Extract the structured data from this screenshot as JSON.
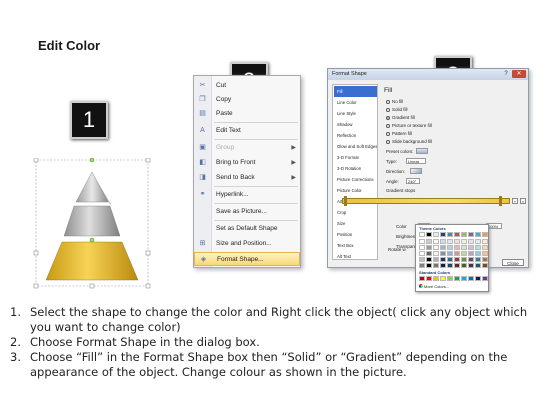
{
  "title": "Edit Color",
  "step_badges": [
    "1",
    "2",
    "3"
  ],
  "context_menu": {
    "items": [
      {
        "label": "Cut",
        "icon": "scissors-icon",
        "glyph": "✂",
        "enabled": true,
        "submenu": false
      },
      {
        "label": "Copy",
        "icon": "copy-icon",
        "glyph": "❐",
        "enabled": true,
        "submenu": false
      },
      {
        "label": "Paste",
        "icon": "paste-icon",
        "glyph": "▤",
        "enabled": true,
        "submenu": false
      },
      {
        "label": "Edit Text",
        "icon": "edit-text-icon",
        "glyph": "A",
        "enabled": true,
        "submenu": false
      },
      {
        "label": "Group",
        "icon": "group-icon",
        "glyph": "▣",
        "enabled": false,
        "submenu": true
      },
      {
        "label": "Bring to Front",
        "icon": "bring-to-front-icon",
        "glyph": "◧",
        "enabled": true,
        "submenu": true
      },
      {
        "label": "Send to Back",
        "icon": "send-to-back-icon",
        "glyph": "◨",
        "enabled": true,
        "submenu": true
      },
      {
        "label": "Hyperlink...",
        "icon": "hyperlink-icon",
        "glyph": "⚭",
        "enabled": true,
        "submenu": false
      },
      {
        "label": "Save as Picture...",
        "icon": "",
        "glyph": "",
        "enabled": true,
        "submenu": false
      },
      {
        "label": "Set as Default Shape",
        "icon": "",
        "glyph": "",
        "enabled": true,
        "submenu": false
      },
      {
        "label": "Size and Position...",
        "icon": "size-position-icon",
        "glyph": "⊞",
        "enabled": true,
        "submenu": false
      },
      {
        "label": "Format Shape...",
        "icon": "format-shape-icon",
        "glyph": "◈",
        "enabled": true,
        "submenu": false,
        "highlighted": true
      }
    ]
  },
  "format_dialog": {
    "title": "Format Shape",
    "help": "?",
    "close_glyph": "✕",
    "nav_items": [
      "Fill",
      "Line Color",
      "Line Style",
      "Shadow",
      "Reflection",
      "Glow and Soft Edges",
      "3-D Format",
      "3-D Rotation",
      "Picture Corrections",
      "Picture Color",
      "Artistic Effects",
      "Crop",
      "Size",
      "Position",
      "Text Box",
      "Alt Text"
    ],
    "selected_nav": "Fill",
    "fill": {
      "heading": "Fill",
      "options": [
        {
          "label": "No fill",
          "selected": false
        },
        {
          "label": "Solid fill",
          "selected": false
        },
        {
          "label": "Gradient fill",
          "selected": true
        },
        {
          "label": "Picture or texture fill",
          "selected": false
        },
        {
          "label": "Pattern fill",
          "selected": false
        },
        {
          "label": "Slide background fill",
          "selected": false
        }
      ],
      "preset_colors_label": "Preset colors:",
      "type_label": "Type:",
      "type_value": "Linear",
      "direction_label": "Direction:",
      "angle_label": "Angle:",
      "angle_value": "240°",
      "gradient_stops_label": "Gradient stops",
      "color_label": "Color",
      "position_label": "Position:",
      "position_value": "100%",
      "brightness_label": "Brightness",
      "transparency_label": "Transparen",
      "rotate_label": "Rotate w"
    },
    "close_button": "Close"
  },
  "color_picker": {
    "theme_heading": "Theme Colors",
    "standard_heading": "Standard Colors",
    "more_colors": "More Colors...",
    "theme_top_row": [
      "#ffffff",
      "#000000",
      "#eeece1",
      "#1f497d",
      "#4f81bd",
      "#c0504d",
      "#9bbb59",
      "#8064a2",
      "#4bacc6",
      "#f79646"
    ],
    "standard_colors": [
      "#c00000",
      "#ff0000",
      "#ffc000",
      "#ffff00",
      "#92d050",
      "#00b050",
      "#00b0f0",
      "#0070c0",
      "#002060",
      "#7030a0"
    ]
  },
  "instructions": [
    {
      "n": "1.",
      "text": "Select the shape to change the color and Right click the object( click any object which you want to change color)"
    },
    {
      "n": "2.",
      "text": "Choose Format Shape in the dialog box."
    },
    {
      "n": "3.",
      "text": "Choose “Fill” in the Format Shape box then “Solid” or “Gradient” depending on the appearance of the object. Change colour as shown in the picture."
    }
  ],
  "colors": {
    "pyramid_top": "#c8c8c8",
    "pyramid_mid": "#b0b0b0",
    "pyramid_base": "#f1c232",
    "menu_highlight": "#f7d778",
    "nav_selected": "#3a6fd0"
  }
}
